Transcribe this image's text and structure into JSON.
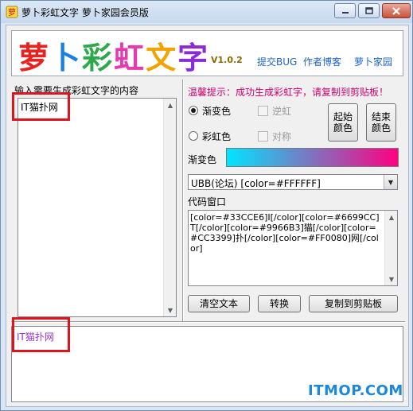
{
  "window": {
    "title": "萝卜彩虹文字  萝卜家园会员版"
  },
  "banner": {
    "logo_chars": [
      "萝",
      "卜",
      "彩",
      "虹",
      "文",
      "字"
    ],
    "logo_colors": [
      "#e8231f",
      "#1b7fe0",
      "#2da84a",
      "#e83ab0",
      "#f2a300",
      "#8a2bd8"
    ],
    "version": "V1.0.2",
    "links": [
      "提交BUG",
      "作者博客",
      "萝卜家园"
    ]
  },
  "left": {
    "label": "输入需要生成彩虹文字的内容",
    "input_value": "IT猫扑网"
  },
  "tip": "温馨提示：成功生成彩虹字，请复制到剪贴板！",
  "options": {
    "gradient": {
      "label": "渐变色",
      "checked": true
    },
    "rainbow": {
      "label": "彩虹色",
      "checked": false
    },
    "reverse": {
      "label": "逆虹",
      "checked": false,
      "disabled": true
    },
    "symmetric": {
      "label": "对称",
      "checked": false,
      "disabled": true
    }
  },
  "buttons": {
    "start_color": "起始颜色",
    "end_color": "结束颜色",
    "clear": "清空文本",
    "convert": "转换",
    "copy": "复制到剪贴板"
  },
  "gradient": {
    "label": "渐变色",
    "start_color": "#00e5ff",
    "end_color": "#ff0080"
  },
  "format_select": {
    "value": "UBB(论坛) [color=#FFFFFF]"
  },
  "code": {
    "label": "代码窗口",
    "content": "[color=#33CCE6]I[/color][color=#6699CC]T[/color][color=#9966B3]猫[/color][color=#CC3399]扑[/color][color=#FF0080]网[/color]"
  },
  "output": {
    "text": "IT猫扑网",
    "color": "#9932cc"
  },
  "watermark": "ITMOP.COM",
  "highlight_color": "#e0141e"
}
